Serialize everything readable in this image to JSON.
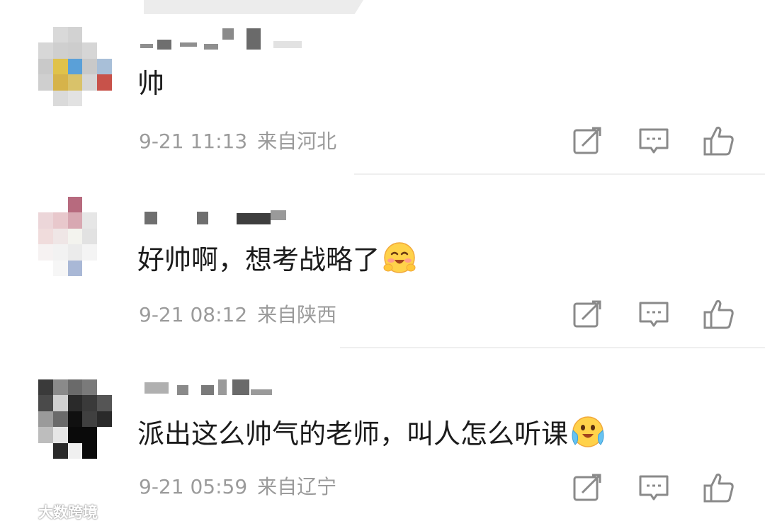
{
  "comments": [
    {
      "text": "帅",
      "date": "9-21 11:13",
      "location": "来自河北",
      "emoji": ""
    },
    {
      "text": "好帅啊，想考战略了",
      "date": "9-21 08:12",
      "location": "来自陕西",
      "emoji": "blushing-smile-emoji"
    },
    {
      "text": "派出这么帅气的老师，叫人怎么听课",
      "date": "9-21 05:59",
      "location": "来自辽宁",
      "emoji": "tearful-joy-emoji"
    }
  ],
  "icons": {
    "repost": "repost-icon",
    "reply": "reply-icon",
    "like": "like-icon"
  },
  "watermark": {
    "text": "大数跨境"
  },
  "colors": {
    "text": "#1b1b1b",
    "meta": "#9b9b9b",
    "icon": "#8a8a8a",
    "divider": "#efefef",
    "background": "#ffffff"
  }
}
